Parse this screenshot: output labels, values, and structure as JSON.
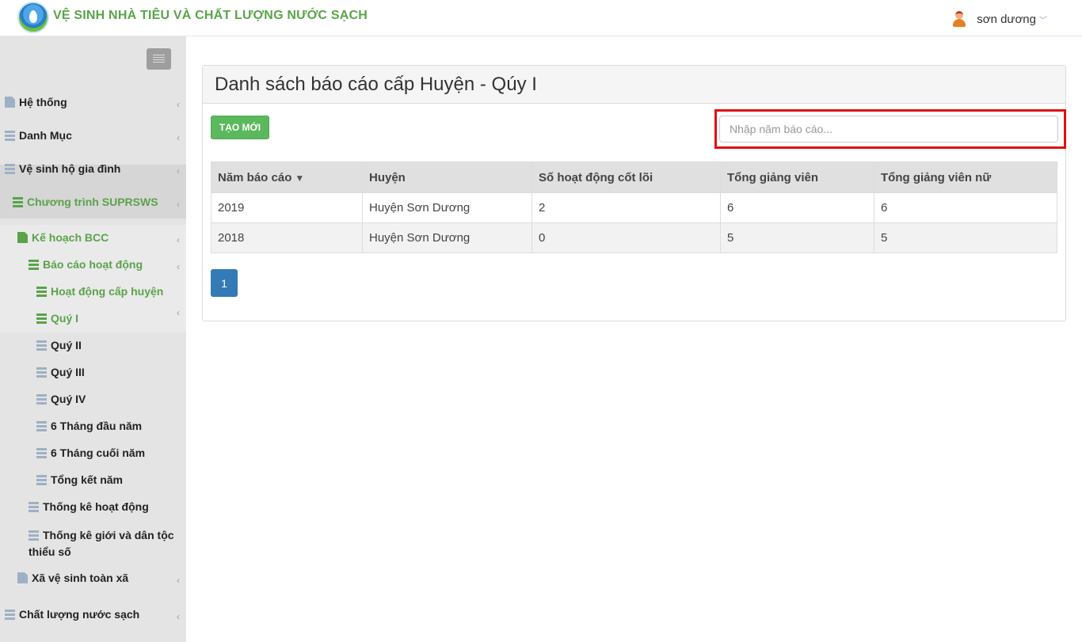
{
  "header": {
    "app_title": "VỆ SINH NHÀ TIÊU VÀ CHẤT LƯỢNG NƯỚC SẠCH",
    "user_name": "sơn dương"
  },
  "sidebar": {
    "items": [
      {
        "label": "Hệ thống"
      },
      {
        "label": "Danh Mục"
      },
      {
        "label": "Vệ sinh hộ gia đình"
      },
      {
        "label": "Chương trình SUPRSWS"
      },
      {
        "label": "Kế hoạch BCC"
      },
      {
        "label": "Báo cáo hoạt động"
      },
      {
        "label": "Hoạt động cấp huyện"
      },
      {
        "label": "Quý I"
      },
      {
        "label": "Quý II"
      },
      {
        "label": "Quý III"
      },
      {
        "label": "Quý IV"
      },
      {
        "label": "6 Tháng đầu năm"
      },
      {
        "label": "6 Tháng cuối năm"
      },
      {
        "label": "Tổng kết năm"
      },
      {
        "label": "Thống kê hoạt động"
      },
      {
        "label": "Thống kê giới và dân tộc thiểu số"
      },
      {
        "label": "Xã vệ sinh toàn xã"
      },
      {
        "label": "Chất lượng nước sạch"
      }
    ]
  },
  "main": {
    "title": "Danh sách báo cáo cấp Huyện - Qúy I",
    "new_button": "TẠO MỚI",
    "search_placeholder": "Nhập năm báo cáo...",
    "table": {
      "headers": [
        "Năm báo cáo",
        "Huyện",
        "Số hoạt động cốt lõi",
        "Tổng giảng viên",
        "Tổng giảng viên nữ"
      ],
      "rows": [
        [
          "2019",
          "Huyện Sơn Dương",
          "2",
          "6",
          "6"
        ],
        [
          "2018",
          "Huyện Sơn Dương",
          "0",
          "5",
          "5"
        ]
      ]
    },
    "pagination": {
      "current_page": "1"
    }
  },
  "colors": {
    "brand_green": "#5aa34a",
    "primary_blue": "#337ab7",
    "highlight_red": "#e01010"
  }
}
